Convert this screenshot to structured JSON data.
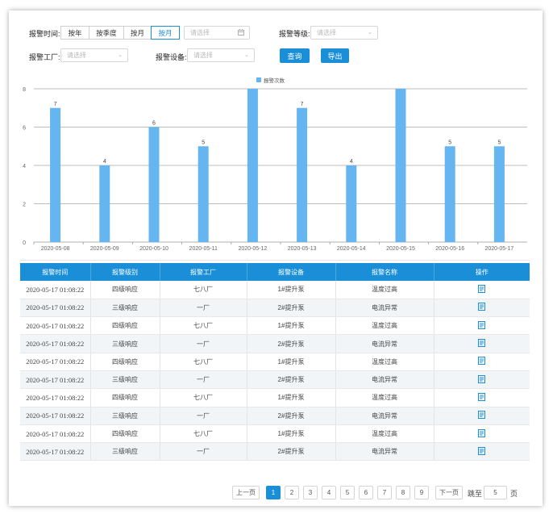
{
  "filters": {
    "time_label": "报警时间:",
    "time_modes": [
      "按年",
      "按季度",
      "按月",
      "按月"
    ],
    "active_mode_index": 3,
    "date_placeholder": "请选择",
    "level_label": "报警等级:",
    "level_placeholder": "请选择",
    "factory_label": "报警工厂:",
    "factory_placeholder": "请选择",
    "device_label": "报警设备:",
    "device_placeholder": "请选择",
    "query_label": "查询",
    "export_label": "导出"
  },
  "icons": {
    "calendar": "calendar-icon",
    "dropdown": "chevron-down-icon",
    "operation": "document-icon"
  },
  "colors": {
    "accent": "#1a8fd8",
    "bar": "#64b5f0",
    "row_alt": "#f2f5f8"
  },
  "chart_data": {
    "type": "bar",
    "categories": [
      "2020-05-08",
      "2020-05-09",
      "2020-05-10",
      "2020-05-11",
      "2020-05-12",
      "2020-05-13",
      "2020-05-14",
      "2020-05-15",
      "2020-05-16",
      "2020-05-17"
    ],
    "series": [
      {
        "name": "报警次数",
        "values": [
          7,
          4,
          6,
          5,
          8,
          7,
          4,
          8,
          5,
          5
        ],
        "data_labels": [
          "7",
          "4",
          "6",
          "5",
          "",
          "7",
          "4",
          "",
          "5",
          "5"
        ]
      }
    ],
    "yticks": [
      0,
      2,
      4,
      6,
      8
    ],
    "ylim": [
      0,
      8
    ],
    "grid": true,
    "legend_position": "top-center"
  },
  "table": {
    "columns": [
      "报警时间",
      "报警级别",
      "报警工厂",
      "报警设备",
      "报警名称",
      "操作"
    ],
    "rows": [
      [
        "2020-05-17 01:08:22",
        "四级响应",
        "七八厂",
        "1#提升泵",
        "温度过高"
      ],
      [
        "2020-05-17 01:08:22",
        "三级响应",
        "一厂",
        "2#提升泵",
        "电流异常"
      ],
      [
        "2020-05-17 01:08:22",
        "四级响应",
        "七八厂",
        "1#提升泵",
        "温度过高"
      ],
      [
        "2020-05-17 01:08:22",
        "三级响应",
        "一厂",
        "2#提升泵",
        "电流异常"
      ],
      [
        "2020-05-17 01:08:22",
        "四级响应",
        "七八厂",
        "1#提升泵",
        "温度过高"
      ],
      [
        "2020-05-17 01:08:22",
        "三级响应",
        "一厂",
        "2#提升泵",
        "电流异常"
      ],
      [
        "2020-05-17 01:08:22",
        "四级响应",
        "七八厂",
        "1#提升泵",
        "温度过高"
      ],
      [
        "2020-05-17 01:08:22",
        "三级响应",
        "一厂",
        "2#提升泵",
        "电流异常"
      ],
      [
        "2020-05-17 01:08:22",
        "四级响应",
        "七八厂",
        "1#提升泵",
        "温度过高"
      ],
      [
        "2020-05-17 01:08:22",
        "三级响应",
        "一厂",
        "2#提升泵",
        "电流异常"
      ]
    ]
  },
  "pagination": {
    "prev_label": "上一页",
    "next_label": "下一页",
    "pages": [
      "1",
      "2",
      "3",
      "4",
      "5",
      "6",
      "7",
      "8",
      "9"
    ],
    "current_page": "1",
    "jump_label": "跳至",
    "jump_value": "5",
    "page_suffix": "页"
  }
}
